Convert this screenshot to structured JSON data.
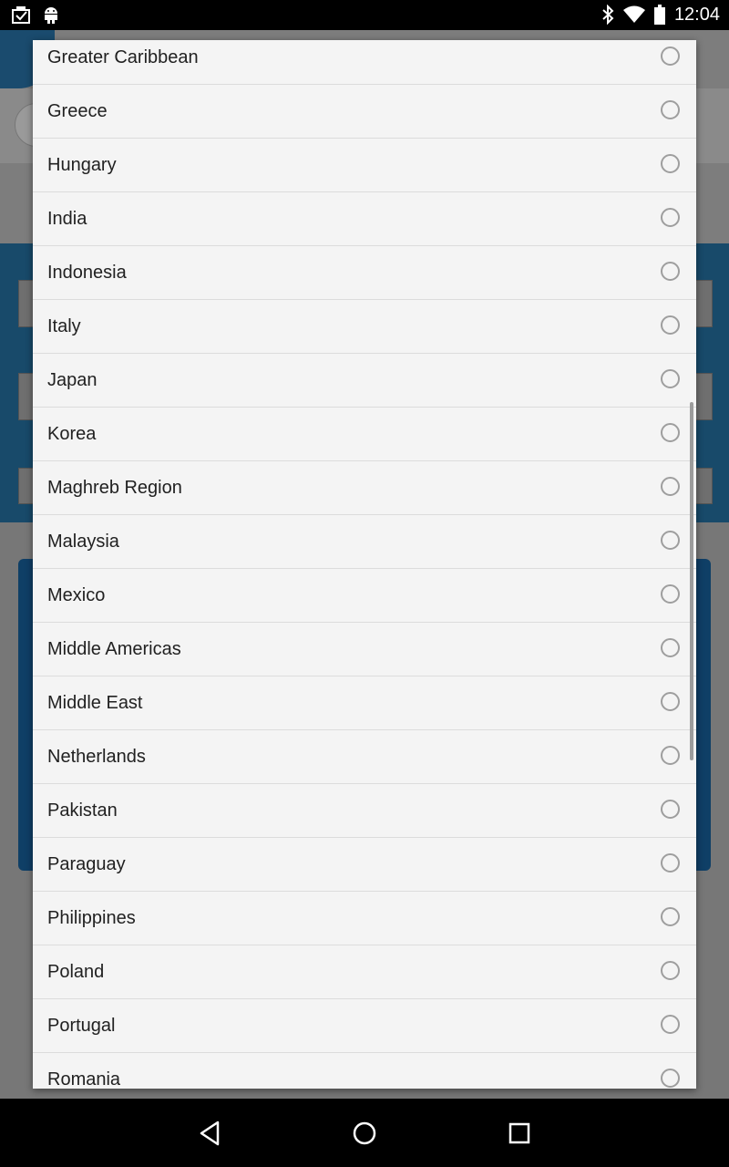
{
  "status_bar": {
    "time": "12:04",
    "left_icons": [
      "notification-icon",
      "android-icon"
    ],
    "right_icons": [
      "bluetooth-icon",
      "wifi-icon",
      "battery-icon"
    ]
  },
  "dialog": {
    "options": [
      {
        "label": "Greater Caribbean",
        "selected": false
      },
      {
        "label": "Greece",
        "selected": false
      },
      {
        "label": "Hungary",
        "selected": false
      },
      {
        "label": "India",
        "selected": false
      },
      {
        "label": "Indonesia",
        "selected": false
      },
      {
        "label": "Italy",
        "selected": false
      },
      {
        "label": "Japan",
        "selected": false
      },
      {
        "label": "Korea",
        "selected": false
      },
      {
        "label": "Maghreb Region",
        "selected": false
      },
      {
        "label": "Malaysia",
        "selected": false
      },
      {
        "label": "Mexico",
        "selected": false
      },
      {
        "label": "Middle Americas",
        "selected": false
      },
      {
        "label": "Middle East",
        "selected": false
      },
      {
        "label": "Netherlands",
        "selected": false
      },
      {
        "label": "Pakistan",
        "selected": false
      },
      {
        "label": "Paraguay",
        "selected": false
      },
      {
        "label": "Philippines",
        "selected": false
      },
      {
        "label": "Poland",
        "selected": false
      },
      {
        "label": "Portugal",
        "selected": false
      },
      {
        "label": "Romania",
        "selected": false
      }
    ]
  },
  "nav_bar": {
    "buttons": [
      "back-icon",
      "home-icon",
      "recents-icon"
    ]
  },
  "colors": {
    "dialog_bg": "#f4f4f4",
    "divider": "#dcdcdc",
    "radio_border": "#9e9e9e",
    "scrim_blue": "#184a6a"
  }
}
